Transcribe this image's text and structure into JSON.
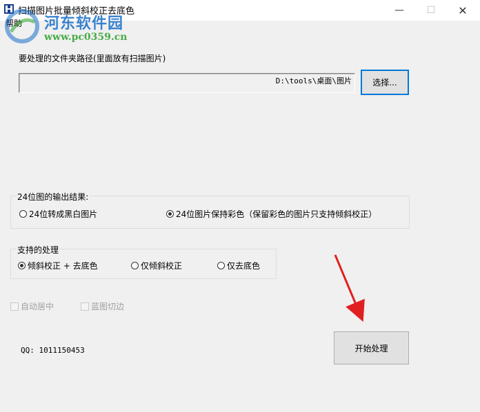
{
  "window": {
    "title": "扫描图片批量倾斜校正去底色",
    "controls": [
      "minimize-icon",
      "maximize-icon",
      "close-icon"
    ]
  },
  "menu": {
    "help": "帮助"
  },
  "watermark": {
    "brand": "河东软件园",
    "url": "www.pc0359.cn"
  },
  "folder": {
    "label": "要处理的文件夹路径(里面放有扫描图片)",
    "path": "D:\\tools\\桌面\\图片",
    "browse_button": "选择..."
  },
  "output_group": {
    "title": "24位图的输出结果:",
    "options": [
      {
        "label": "24位转成黑白图片",
        "selected": false
      },
      {
        "label": "24位图片保持彩色（保留彩色的图片只支持倾斜校正）",
        "selected": true
      }
    ]
  },
  "process_group": {
    "title": "支持的处理",
    "options": [
      {
        "label": "倾斜校正 + 去底色",
        "selected": true
      },
      {
        "label": "仅倾斜校正",
        "selected": false
      },
      {
        "label": "仅去底色",
        "selected": false
      }
    ]
  },
  "checkboxes": [
    {
      "label": "自动居中",
      "checked": false,
      "enabled": false
    },
    {
      "label": "蓝图切边",
      "checked": false,
      "enabled": false
    }
  ],
  "qq": "QQ: 1011150453",
  "start_button": "开始处理",
  "colors": {
    "accent": "#0078d7",
    "arrow": "#e02020",
    "watermark_blue": "#1a6fc9",
    "watermark_green": "#2aa02a"
  }
}
